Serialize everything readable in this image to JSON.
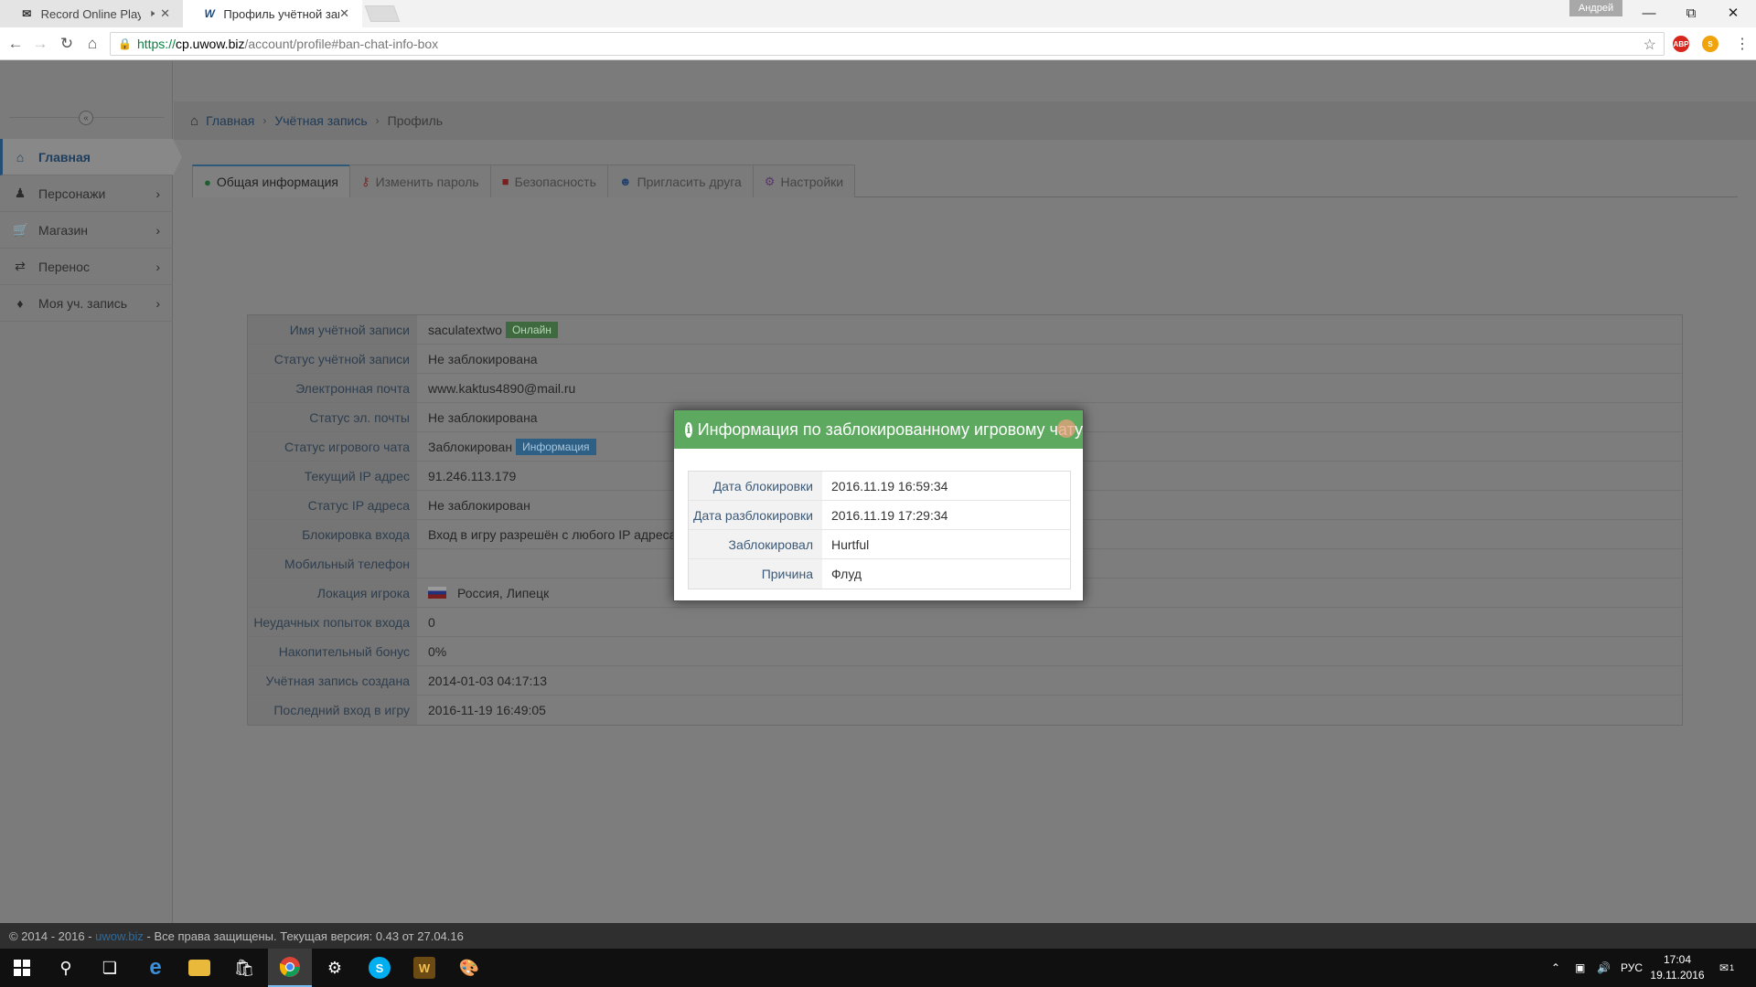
{
  "browser": {
    "tabs": [
      {
        "title": "Record Online Player",
        "favicon": "mail-icon"
      },
      {
        "title": "Профиль учётной запис",
        "favicon": "uwow-icon"
      }
    ],
    "user": "Андрей",
    "url": {
      "scheme": "https://",
      "host": "cp.uwow.biz",
      "path": "/account/profile#ban-chat-info-box"
    },
    "extensions": [
      {
        "label": "ABP",
        "color": "#d8261e"
      },
      {
        "label": "S",
        "color": "#f0a30a"
      }
    ]
  },
  "sidebar": {
    "items": [
      {
        "label": "Главная",
        "icon": "home-icon",
        "active": true
      },
      {
        "label": "Персонажи",
        "icon": "character-icon"
      },
      {
        "label": "Магазин",
        "icon": "cart-icon"
      },
      {
        "label": "Перенос",
        "icon": "transfer-icon"
      },
      {
        "label": "Моя уч. запись",
        "icon": "tag-icon"
      }
    ]
  },
  "breadcrumb": {
    "home": "Главная",
    "account": "Учётная запись",
    "current": "Профиль"
  },
  "tabs": [
    {
      "label": "Общая информация",
      "icon": "lightbulb-icon",
      "active": true
    },
    {
      "label": "Изменить пароль",
      "icon": "key-icon"
    },
    {
      "label": "Безопасность",
      "icon": "lock-icon"
    },
    {
      "label": "Пригласить друга",
      "icon": "users-icon"
    },
    {
      "label": "Настройки",
      "icon": "gear-icon"
    }
  ],
  "profile": {
    "rows": [
      {
        "label": "Имя учётной записи",
        "value": "saculatextwo",
        "badge": "Онлайн",
        "badge_color": "green"
      },
      {
        "label": "Статус учётной записи",
        "value": "Не заблокирована"
      },
      {
        "label": "Электронная почта",
        "value": "www.kaktus4890@mail.ru"
      },
      {
        "label": "Статус эл. почты",
        "value": "Не заблокирована"
      },
      {
        "label": "Статус игрового чата",
        "value": "Заблокирован",
        "badge": "Информация",
        "badge_color": "blue"
      },
      {
        "label": "Текущий IP адрес",
        "value": "91.246.113.179"
      },
      {
        "label": "Статус IP адреса",
        "value": "Не заблокирован"
      },
      {
        "label": "Блокировка входа",
        "value": "Вход в игру разрешён с любого IP адреса"
      },
      {
        "label": "Мобильный телефон",
        "value": ""
      },
      {
        "label": "Локация игрока",
        "value": "Россия, Липецк",
        "flag": true
      },
      {
        "label": "Неудачных попыток входа",
        "value": "0"
      },
      {
        "label": "Накопительный бонус",
        "value": "0%"
      },
      {
        "label": "Учётная запись создана",
        "value": "2014-01-03 04:17:13"
      },
      {
        "label": "Последний вход в игру",
        "value": "2016-11-19 16:49:05"
      }
    ]
  },
  "modal": {
    "title": "Информация по заблокированному игровому чату",
    "rows": [
      {
        "label": "Дата блокировки",
        "value": "2016.11.19 16:59:34"
      },
      {
        "label": "Дата разблокировки",
        "value": "2016.11.19 17:29:34"
      },
      {
        "label": "Заблокировал",
        "value": "Hurtful"
      },
      {
        "label": "Причина",
        "value": "Флуд"
      }
    ]
  },
  "footer": {
    "prefix": "© 2014 - 2016 - ",
    "link": "uwow.biz",
    "suffix": " - Все права защищены. Текущая версия: 0.43 от 27.04.16"
  },
  "taskbar": {
    "lang": "РУС",
    "time": "17:04",
    "date": "19.11.2016",
    "notifications": "1"
  }
}
